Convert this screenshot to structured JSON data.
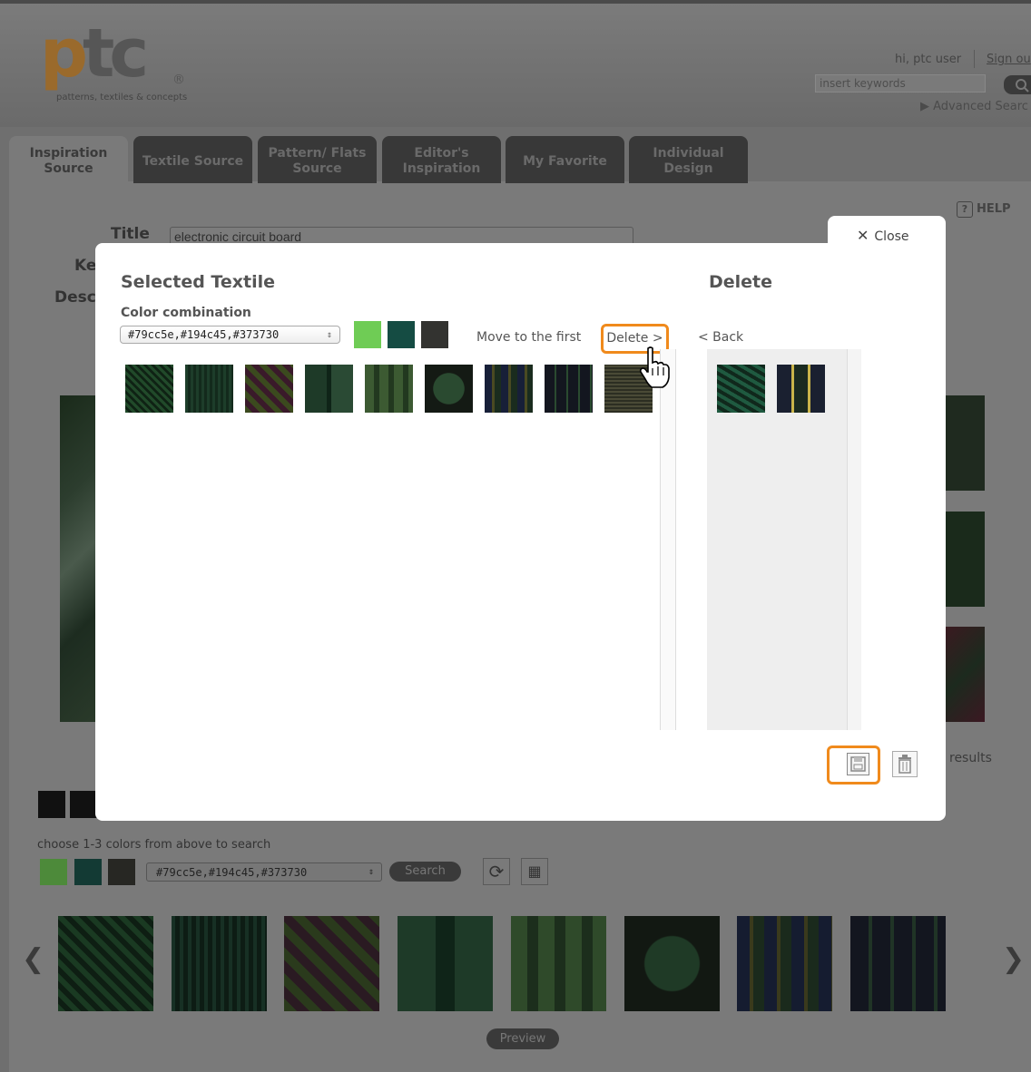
{
  "header": {
    "logo_text": "ptc",
    "logo_reg": "®",
    "logo_tagline": "patterns, textiles & concepts",
    "greeting": "hi, ptc user",
    "sign_out": "Sign ou",
    "search_placeholder": "insert keywords",
    "advanced_search": "▶ Advanced Searc"
  },
  "tabs": [
    {
      "label": "Inspiration Source",
      "active": true
    },
    {
      "label": "Textile Source",
      "active": false
    },
    {
      "label": "Pattern/ Flats Source",
      "active": false
    },
    {
      "label": "Editor's Inspiration",
      "active": false
    },
    {
      "label": "My Favorite",
      "active": false
    },
    {
      "label": "Individual Design",
      "active": false
    }
  ],
  "form": {
    "help": "HELP",
    "title_label": "Title",
    "title_value": "electronic circuit board",
    "ke_label": "Ke",
    "desc_label": "Desc"
  },
  "background": {
    "results_text": "results",
    "choose_text": "choose 1-3 colors from above to search",
    "color_combo": "#79cc5e,#194c45,#373730",
    "search_label": "Search",
    "preview_label": "Preview",
    "prev_arrow": "❮",
    "next_arrow": "❯"
  },
  "modal": {
    "close_label": "Close",
    "selected_title": "Selected Textile",
    "delete_title": "Delete",
    "color_combo_label": "Color combination",
    "color_combo_value": "#79cc5e,#194c45,#373730",
    "swatches": [
      "#6fcc55",
      "#154c43",
      "#333330"
    ],
    "move_first": "Move to the first",
    "delete_button": "Delete >",
    "back_button": "< Back"
  },
  "icons": {
    "close": "close-icon",
    "help": "help-icon",
    "save": "save-icon",
    "trash": "trash-icon",
    "refresh": "refresh-icon",
    "grid": "grid-icon",
    "cursor": "hand-cursor-icon",
    "search": "search-icon"
  },
  "accent_color": "#f08a1c"
}
